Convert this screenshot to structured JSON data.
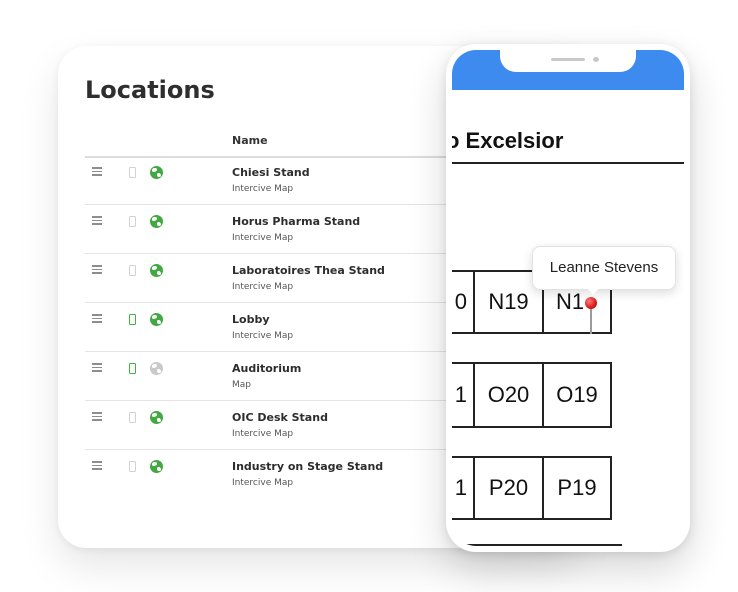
{
  "locations_panel": {
    "title": "Locations",
    "column_name": "Name",
    "rows": [
      {
        "name": "Chiesi Stand",
        "type": "Intercive Map",
        "mobile_enabled": false,
        "web_enabled": true
      },
      {
        "name": "Horus Pharma Stand",
        "type": "Intercive Map",
        "mobile_enabled": false,
        "web_enabled": true
      },
      {
        "name": "Laboratoires Thea Stand",
        "type": "Intercive Map",
        "mobile_enabled": false,
        "web_enabled": true
      },
      {
        "name": "Lobby",
        "type": "Intercive Map",
        "mobile_enabled": true,
        "web_enabled": true
      },
      {
        "name": "Auditorium",
        "type": "Map",
        "mobile_enabled": true,
        "web_enabled": false
      },
      {
        "name": "OIC Desk Stand",
        "type": "Intercive Map",
        "mobile_enabled": false,
        "web_enabled": true
      },
      {
        "name": "Industry on Stage Stand",
        "type": "Intercive Map",
        "mobile_enabled": false,
        "web_enabled": true
      }
    ],
    "icons": {
      "drag": "drag-handle-icon",
      "mobile": "mobile-phone-icon",
      "web": "globe-icon"
    },
    "colors": {
      "enabled": "#42a842",
      "disabled": "#c9c9c9"
    }
  },
  "phone_preview": {
    "status_bar_color": "#3e8bf0",
    "map_title": "o Excelsior",
    "tooltip": "Leanne Stevens",
    "cells": {
      "n_partial": "0",
      "n1": "N19",
      "n2": "N1",
      "o_partial": "1",
      "o1": "O20",
      "o2": "O19",
      "p_partial": "1",
      "p1": "P20",
      "p2": "P19"
    },
    "pin_icon": "map-pin-icon"
  }
}
